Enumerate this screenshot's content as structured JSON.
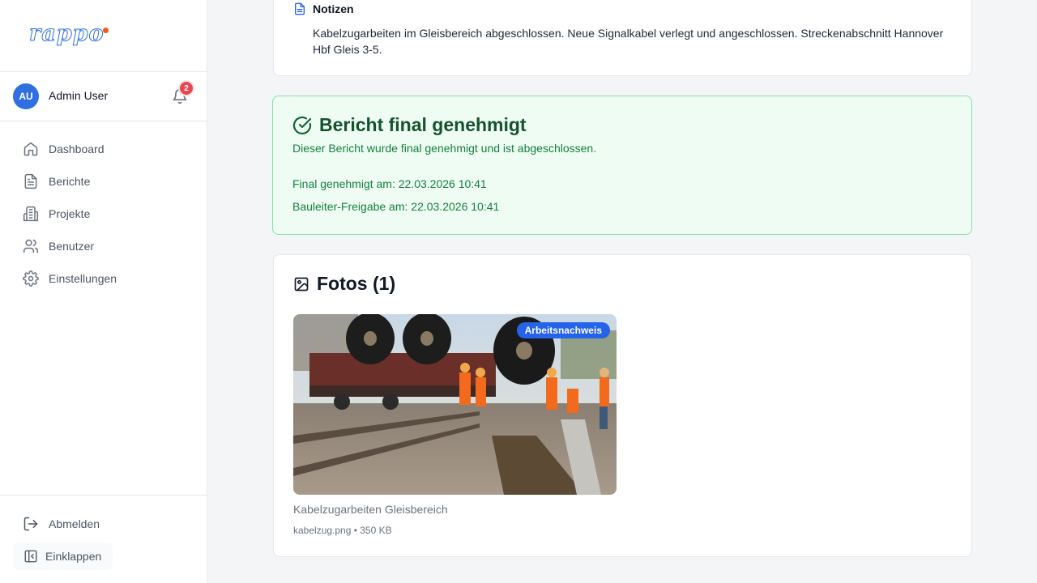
{
  "brand": {
    "logo_text": "rappo",
    "accent": "#2f6fe0",
    "dot_color": "#f05a1a"
  },
  "user": {
    "initials": "AU",
    "name": "Admin User",
    "notifications": "2"
  },
  "nav": [
    {
      "label": "Dashboard",
      "icon": "home-icon"
    },
    {
      "label": "Berichte",
      "icon": "file-text-icon"
    },
    {
      "label": "Projekte",
      "icon": "building-icon"
    },
    {
      "label": "Benutzer",
      "icon": "users-icon"
    },
    {
      "label": "Einstellungen",
      "icon": "gear-icon"
    }
  ],
  "sidebar_bottom": {
    "logout": "Abmelden",
    "collapse": "Einklappen"
  },
  "notes": {
    "title": "Notizen",
    "text": "Kabelzugarbeiten im Gleisbereich abgeschlossen. Neue Signalkabel verlegt und angeschlossen. Streckenabschnitt Hannover Hbf Gleis 3-5."
  },
  "approval": {
    "title": "Bericht final genehmigt",
    "subtitle": "Dieser Bericht wurde final genehmigt und ist abgeschlossen.",
    "final_line": "Final genehmigt am: 22.03.2026 10:41",
    "release_line": "Bauleiter-Freigabe am: 22.03.2026 10:41"
  },
  "photos": {
    "title": "Fotos (1)",
    "items": [
      {
        "badge": "Arbeitsnachweis",
        "caption": "Kabelzugarbeiten Gleisbereich",
        "meta": "kabelzug.png • 350 KB"
      }
    ]
  }
}
